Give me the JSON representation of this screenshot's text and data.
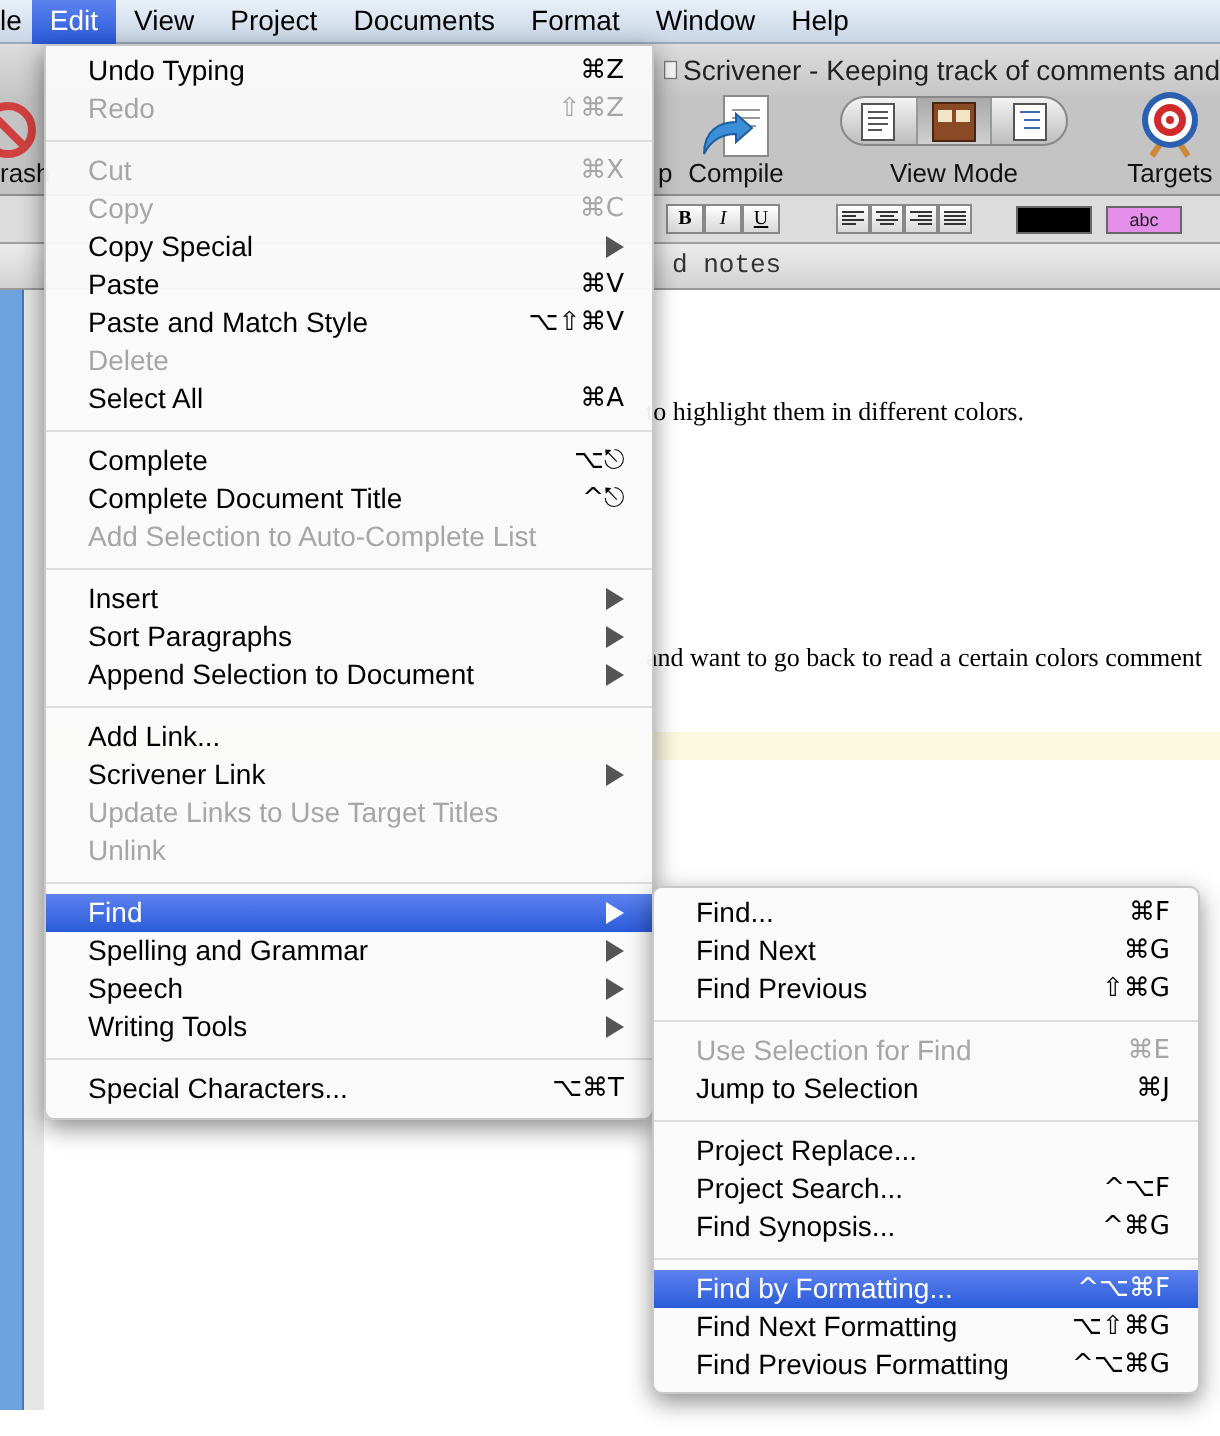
{
  "menu_bar": [
    {
      "label": "le",
      "selected": false
    },
    {
      "label": "Edit",
      "selected": true
    },
    {
      "label": "View",
      "selected": false
    },
    {
      "label": "Project",
      "selected": false
    },
    {
      "label": "Documents",
      "selected": false
    },
    {
      "label": "Format",
      "selected": false
    },
    {
      "label": "Window",
      "selected": false
    },
    {
      "label": "Help",
      "selected": false
    }
  ],
  "window": {
    "title": "Scrivener - Keeping track of comments and"
  },
  "toolbar": [
    {
      "kind": "trash",
      "label": "rash"
    },
    {
      "kind": "partial",
      "label": "p"
    },
    {
      "kind": "compile",
      "label": "Compile"
    },
    {
      "kind": "view_mode",
      "label": "View Mode"
    },
    {
      "kind": "targets",
      "label": "Targets"
    }
  ],
  "view_mode_segments": [
    {
      "kind": "text",
      "selected": false
    },
    {
      "kind": "corkboard",
      "selected": true
    },
    {
      "kind": "outline",
      "selected": false
    }
  ],
  "format_bar": {
    "style_buttons": [
      "B",
      "I",
      "U"
    ],
    "highlight_label": "abc"
  },
  "document_header": "d notes",
  "editor_lines": [
    {
      "text": "to highlight them in different colors."
    },
    {
      "text": "and want to go back to read a certain colors comment"
    }
  ],
  "edit_menu": [
    {
      "kind": "item",
      "label": "Undo Typing",
      "shortcut": "⌘Z",
      "disabled": false,
      "submenu": false,
      "selected": false
    },
    {
      "kind": "item",
      "label": "Redo",
      "shortcut": "⇧⌘Z",
      "disabled": true,
      "submenu": false,
      "selected": false
    },
    {
      "kind": "separator"
    },
    {
      "kind": "item",
      "label": "Cut",
      "shortcut": "⌘X",
      "disabled": true,
      "submenu": false,
      "selected": false
    },
    {
      "kind": "item",
      "label": "Copy",
      "shortcut": "⌘C",
      "disabled": true,
      "submenu": false,
      "selected": false
    },
    {
      "kind": "item",
      "label": "Copy Special",
      "disabled": false,
      "submenu": true,
      "selected": false
    },
    {
      "kind": "item",
      "label": "Paste",
      "shortcut": "⌘V",
      "disabled": false,
      "submenu": false,
      "selected": false
    },
    {
      "kind": "item",
      "label": "Paste and Match Style",
      "shortcut": "⌥⇧⌘V",
      "disabled": false,
      "submenu": false,
      "selected": false
    },
    {
      "kind": "item",
      "label": "Delete",
      "disabled": true,
      "submenu": false,
      "selected": false
    },
    {
      "kind": "item",
      "label": "Select All",
      "shortcut": "⌘A",
      "disabled": false,
      "submenu": false,
      "selected": false
    },
    {
      "kind": "separator"
    },
    {
      "kind": "item",
      "label": "Complete",
      "shortcut": "⌥⎋",
      "disabled": false,
      "submenu": false,
      "selected": false
    },
    {
      "kind": "item",
      "label": "Complete Document Title",
      "shortcut": "^⎋",
      "disabled": false,
      "submenu": false,
      "selected": false
    },
    {
      "kind": "item",
      "label": "Add Selection to Auto-Complete List",
      "disabled": true,
      "submenu": false,
      "selected": false
    },
    {
      "kind": "separator"
    },
    {
      "kind": "item",
      "label": "Insert",
      "disabled": false,
      "submenu": true,
      "selected": false
    },
    {
      "kind": "item",
      "label": "Sort Paragraphs",
      "disabled": false,
      "submenu": true,
      "selected": false
    },
    {
      "kind": "item",
      "label": "Append Selection to Document",
      "disabled": false,
      "submenu": true,
      "selected": false
    },
    {
      "kind": "separator"
    },
    {
      "kind": "item",
      "label": "Add Link...",
      "disabled": false,
      "submenu": false,
      "selected": false
    },
    {
      "kind": "item",
      "label": "Scrivener Link",
      "disabled": false,
      "submenu": true,
      "selected": false
    },
    {
      "kind": "item",
      "label": "Update Links to Use Target Titles",
      "disabled": true,
      "submenu": false,
      "selected": false
    },
    {
      "kind": "item",
      "label": "Unlink",
      "disabled": true,
      "submenu": false,
      "selected": false
    },
    {
      "kind": "separator"
    },
    {
      "kind": "item",
      "label": "Find",
      "disabled": false,
      "submenu": true,
      "selected": true
    },
    {
      "kind": "item",
      "label": "Spelling and Grammar",
      "disabled": false,
      "submenu": true,
      "selected": false
    },
    {
      "kind": "item",
      "label": "Speech",
      "disabled": false,
      "submenu": true,
      "selected": false
    },
    {
      "kind": "item",
      "label": "Writing Tools",
      "disabled": false,
      "submenu": true,
      "selected": false
    },
    {
      "kind": "separator"
    },
    {
      "kind": "item",
      "label": "Special Characters...",
      "shortcut": "⌥⌘T",
      "disabled": false,
      "submenu": false,
      "selected": false
    }
  ],
  "find_submenu": [
    {
      "kind": "item",
      "label": "Find...",
      "shortcut": "⌘F",
      "disabled": false,
      "submenu": false,
      "selected": false
    },
    {
      "kind": "item",
      "label": "Find Next",
      "shortcut": "⌘G",
      "disabled": false,
      "submenu": false,
      "selected": false
    },
    {
      "kind": "item",
      "label": "Find Previous",
      "shortcut": "⇧⌘G",
      "disabled": false,
      "submenu": false,
      "selected": false
    },
    {
      "kind": "separator"
    },
    {
      "kind": "item",
      "label": "Use Selection for Find",
      "shortcut": "⌘E",
      "disabled": true,
      "submenu": false,
      "selected": false
    },
    {
      "kind": "item",
      "label": "Jump to Selection",
      "shortcut": "⌘J",
      "disabled": false,
      "submenu": false,
      "selected": false
    },
    {
      "kind": "separator"
    },
    {
      "kind": "item",
      "label": "Project Replace...",
      "disabled": false,
      "submenu": false,
      "selected": false
    },
    {
      "kind": "item",
      "label": "Project Search...",
      "shortcut": "^⌥F",
      "disabled": false,
      "submenu": false,
      "selected": false
    },
    {
      "kind": "item",
      "label": "Find Synopsis...",
      "shortcut": "^⌘G",
      "disabled": false,
      "submenu": false,
      "selected": false
    },
    {
      "kind": "separator"
    },
    {
      "kind": "item",
      "label": "Find by Formatting...",
      "shortcut": "^⌥⌘F",
      "disabled": false,
      "submenu": false,
      "selected": true
    },
    {
      "kind": "item",
      "label": "Find Next Formatting",
      "shortcut": "⌥⇧⌘G",
      "disabled": false,
      "submenu": false,
      "selected": false
    },
    {
      "kind": "item",
      "label": "Find Previous Formatting",
      "shortcut": "^⌥⌘G",
      "disabled": false,
      "submenu": false,
      "selected": false
    }
  ]
}
